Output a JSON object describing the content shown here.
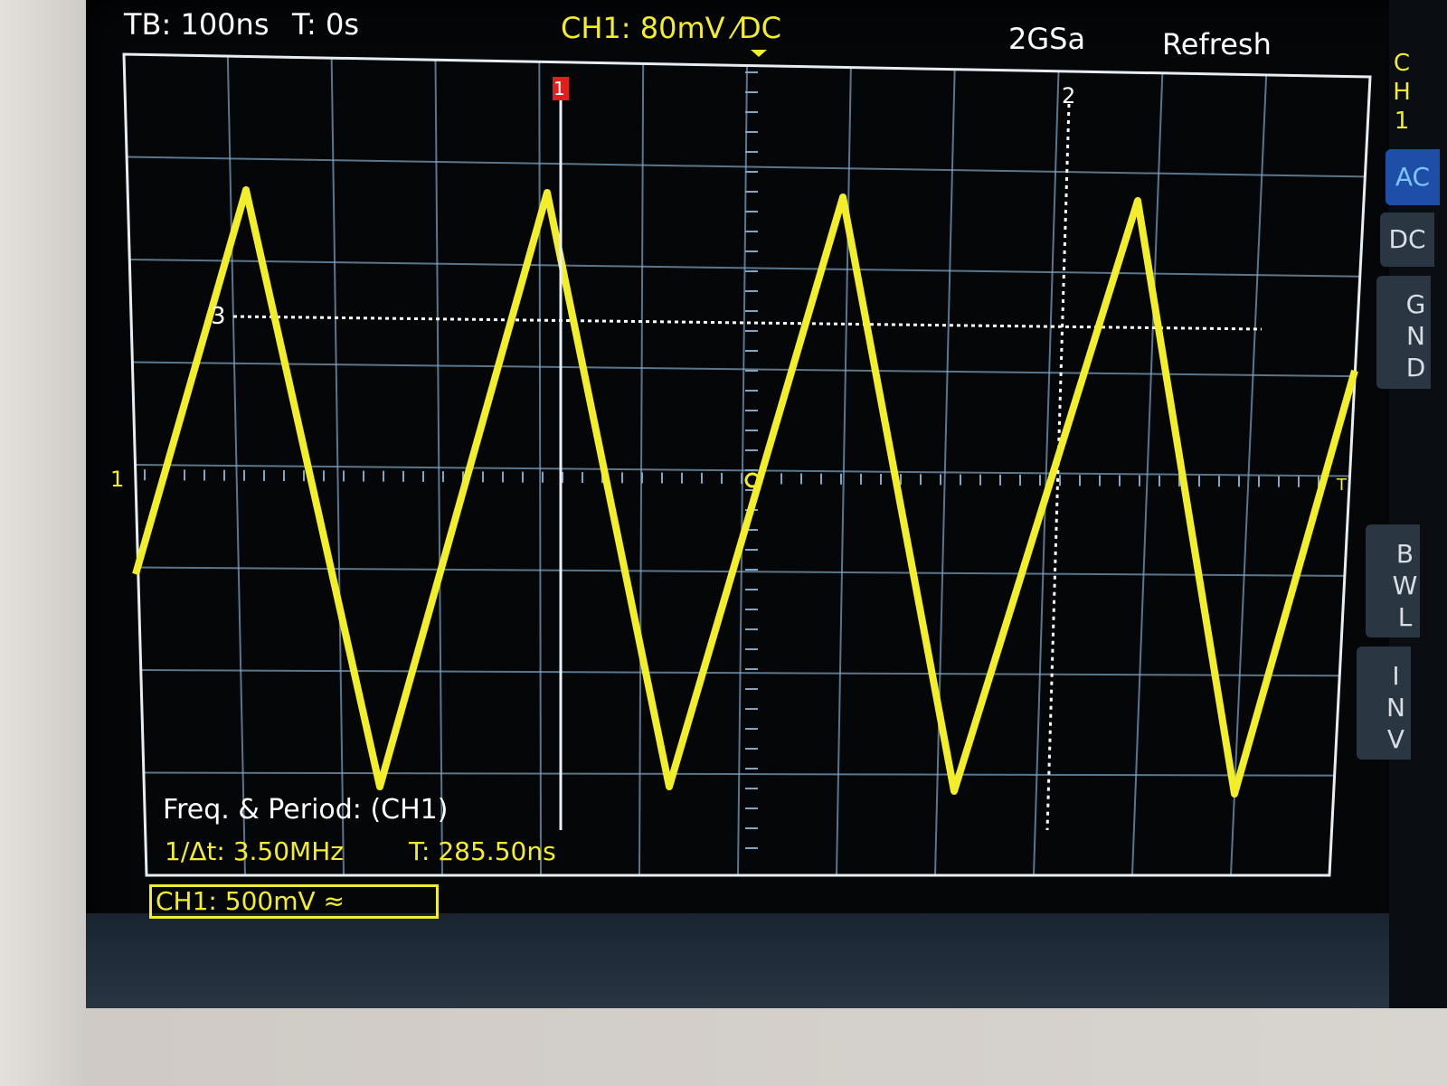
{
  "topbar": {
    "timebase": "TB: 100ns",
    "trigger_time": "T: 0s",
    "channel_setting": "CH1: 80mV ⁄DC",
    "sample_rate": "2GSa",
    "mode": "Refresh"
  },
  "markers": {
    "cursor_1": "1",
    "cursor_2": "2",
    "cursor_3": "3",
    "channel_ref": "1",
    "trigger_ref": "T"
  },
  "measurement": {
    "title": "Freq. & Period: (CH1)",
    "freq": "1/Δt: 3.50MHz",
    "period": "T: 285.50ns"
  },
  "channel_box": "CH1: 500mV ≈",
  "sidebar": {
    "label": "CH1",
    "ac": "AC",
    "dc": "DC",
    "gnd": "GND",
    "bwl": "BWL",
    "inv": "INV"
  },
  "colors": {
    "trace": "#f3ee2a",
    "grid": "#7fa6c4",
    "cursor": "#ffffff",
    "accent_button": "#1e4fa8"
  },
  "waveform": {
    "shape": "triangle",
    "frequency_mhz": 3.5,
    "period_ns": 285.5,
    "timebase_ns_per_div": 100
  }
}
